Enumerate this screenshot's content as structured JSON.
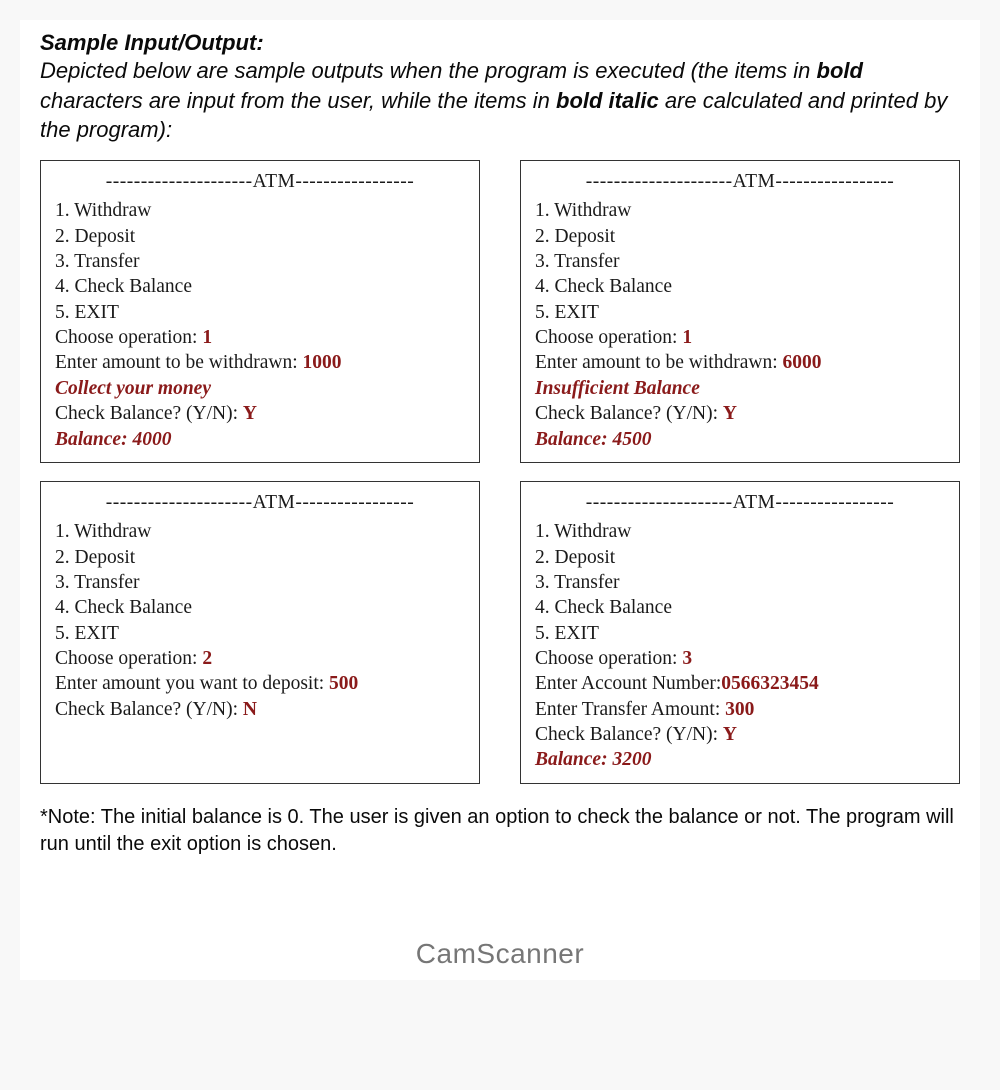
{
  "heading": {
    "title": "Sample Input/Output:",
    "desc_pre": "Depicted below are sample outputs when the program is executed (the items in ",
    "desc_bold": "bold",
    "desc_mid": " characters are input from the user, while the items in ",
    "desc_bolditalic": "bold italic",
    "desc_post": " are calculated and printed by the program):"
  },
  "atm_header": "---------------------ATM-----------------",
  "menu": {
    "m1": "1. Withdraw",
    "m2": "2. Deposit",
    "m3": "3. Transfer",
    "m4": "4. Check Balance",
    "m5": "5. EXIT"
  },
  "box1": {
    "choose_label": "Choose operation: ",
    "choose_val": "1",
    "amt_label": "Enter amount to be withdrawn: ",
    "amt_val": "1000",
    "calc1": "Collect your money",
    "chk_label": "Check Balance? (Y/N): ",
    "chk_val": "Y",
    "balance": "Balance: 4000"
  },
  "box2": {
    "choose_label": "Choose operation: ",
    "choose_val": "1",
    "amt_label": "Enter amount to be withdrawn: ",
    "amt_val": "6000",
    "calc1": "Insufficient Balance",
    "chk_label": "Check Balance? (Y/N): ",
    "chk_val": "Y",
    "balance": "Balance: 4500"
  },
  "box3": {
    "choose_label": "Choose operation: ",
    "choose_val": "2",
    "amt_label": "Enter amount you want to deposit: ",
    "amt_val": "500",
    "chk_label": "Check Balance? (Y/N): ",
    "chk_val": "N"
  },
  "box4": {
    "choose_label": "Choose operation: ",
    "choose_val": "3",
    "acct_label": "Enter Account Number:",
    "acct_val": "0566323454",
    "amt_label": "Enter Transfer Amount: ",
    "amt_val": "300",
    "chk_label": "Check Balance? (Y/N): ",
    "chk_val": "Y",
    "balance": "Balance: 3200"
  },
  "note": "*Note: The initial balance is 0. The user is given an option to check the balance or not. The program will run until the exit option is chosen.",
  "watermark": "CamScanner"
}
